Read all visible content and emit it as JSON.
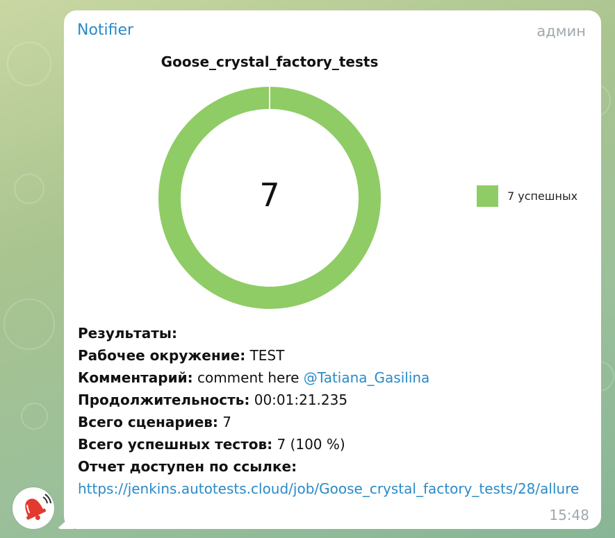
{
  "message": {
    "sender": "Notifier",
    "role": "админ",
    "time": "15:48"
  },
  "chart_data": {
    "type": "pie",
    "title": "Goose_crystal_factory_tests",
    "center_label": "7",
    "slices": [
      {
        "label": "7 успешных",
        "value": 7,
        "color": "#8fcc65"
      }
    ]
  },
  "results": {
    "heading": "Результаты:",
    "env_label": "Рабочее окружение:",
    "env_value": "TEST",
    "comment_label": "Комментарий:",
    "comment_value": "comment here",
    "mention": "@Tatiana_Gasilina",
    "duration_label": "Продолжительность:",
    "duration_value": "00:01:21.235",
    "scenarios_label": "Всего сценариев:",
    "scenarios_value": "7",
    "passed_label": "Всего успешных тестов:",
    "passed_value": "7 (100 %)",
    "report_label": "Отчет доступен по ссылке:",
    "report_url": "https://jenkins.autotests.cloud/job/Goose_crystal_factory_tests/28/allure"
  },
  "icons": {
    "avatar": "bell-icon"
  },
  "colors": {
    "accent": "#2a8ac7",
    "pass": "#8fcc65"
  }
}
